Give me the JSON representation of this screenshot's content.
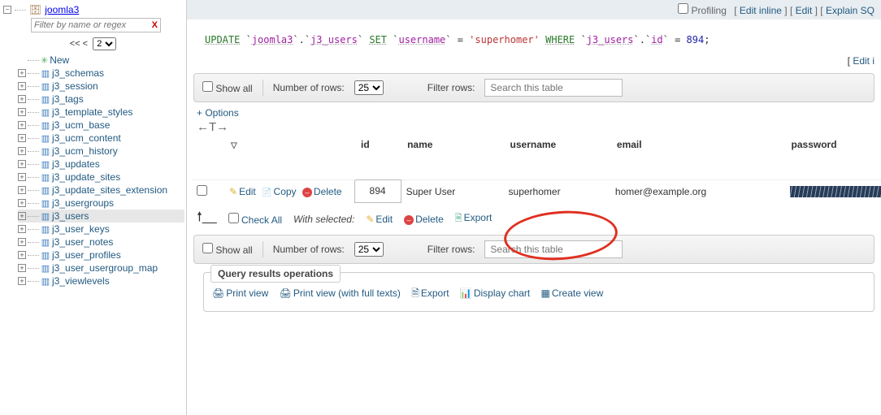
{
  "sidebar": {
    "database": "joomla3",
    "expand_symbol": "−",
    "filter_placeholder": "Filter by name or regex",
    "pager_label": "<< <",
    "pager_page": "2",
    "new_label": "New",
    "tables": [
      "j3_schemas",
      "j3_session",
      "j3_tags",
      "j3_template_styles",
      "j3_ucm_base",
      "j3_ucm_content",
      "j3_ucm_history",
      "j3_updates",
      "j3_update_sites",
      "j3_update_sites_extension",
      "j3_usergroups",
      "j3_users",
      "j3_user_keys",
      "j3_user_notes",
      "j3_user_profiles",
      "j3_user_usergroup_map",
      "j3_viewlevels"
    ],
    "selected_table": "j3_users"
  },
  "topbar": {
    "profiling": "Profiling",
    "links": [
      "Edit inline",
      "Edit",
      "Explain SQ"
    ]
  },
  "sql": {
    "update": "UPDATE",
    "db": "joomla3",
    "table": "j3_users",
    "set": "SET",
    "col_username": "username",
    "val_username": "superhomer",
    "where": "WHERE",
    "ref_table": "j3_users",
    "col_id": "id",
    "val_id": "894",
    "semicolon": ";"
  },
  "editline": {
    "label": "Edit i"
  },
  "toolbar": {
    "showall": "Show all",
    "nor": "Number of rows:",
    "rows": "25",
    "filter_label": "Filter rows:",
    "filter_placeholder": "Search this table"
  },
  "options_label": "+ Options",
  "columns": {
    "id": "id",
    "name": "name",
    "username": "username",
    "email": "email",
    "password": "password"
  },
  "row": {
    "edit": "Edit",
    "copy": "Copy",
    "delete": "Delete",
    "id": "894",
    "name": "Super User",
    "username": "superhomer",
    "email": "homer@example.org"
  },
  "batch": {
    "checkall": "Check All",
    "withsel": "With selected:",
    "edit": "Edit",
    "delete": "Delete",
    "export": "Export"
  },
  "qro": {
    "legend": "Query results operations",
    "print": "Print view",
    "print_full": "Print view (with full texts)",
    "export": "Export",
    "chart": "Display chart",
    "view": "Create view"
  }
}
